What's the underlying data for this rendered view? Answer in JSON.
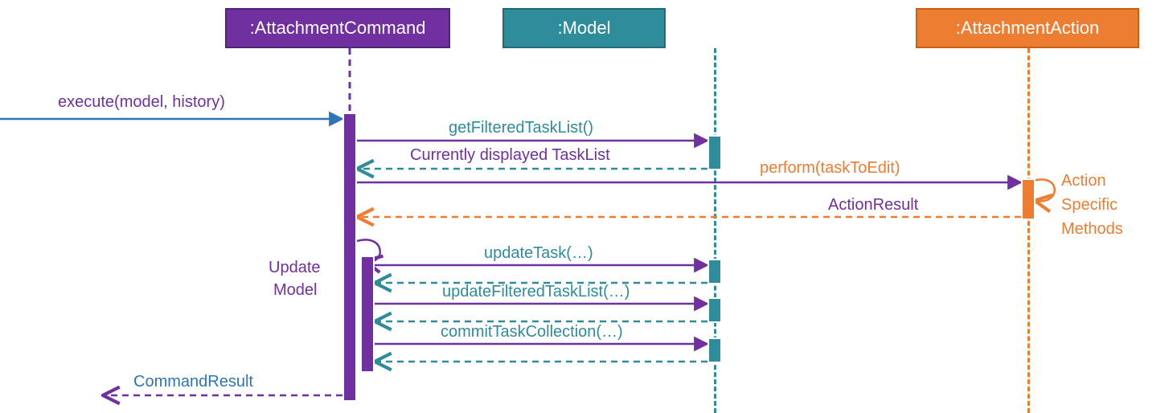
{
  "chart_data": {
    "type": "sequence-diagram",
    "lifelines": [
      {
        "id": "attachmentCommand",
        "label": ":AttachmentCommand",
        "color": "purple"
      },
      {
        "id": "model",
        "label": ":Model",
        "color": "teal"
      },
      {
        "id": "attachmentAction",
        "label": ":AttachmentAction",
        "color": "orange"
      }
    ],
    "messages": [
      {
        "from": "ext",
        "to": "attachmentCommand",
        "label": "execute(model, history)",
        "kind": "call"
      },
      {
        "from": "attachmentCommand",
        "to": "model",
        "label": "getFilteredTaskList()",
        "kind": "call"
      },
      {
        "from": "model",
        "to": "attachmentCommand",
        "label": "Currently displayed TaskList",
        "kind": "return"
      },
      {
        "from": "attachmentCommand",
        "to": "attachmentAction",
        "label": "perform(taskToEdit)",
        "kind": "call"
      },
      {
        "from": "attachmentAction",
        "to": "attachmentAction",
        "label": "Action Specific Methods",
        "kind": "self"
      },
      {
        "from": "attachmentAction",
        "to": "attachmentCommand",
        "label": "ActionResult",
        "kind": "return"
      },
      {
        "from": "attachmentCommand",
        "to": "attachmentCommand",
        "label": "Update Model",
        "kind": "self"
      },
      {
        "from": "attachmentCommand",
        "to": "model",
        "label": "updateTask(…)",
        "kind": "call-return"
      },
      {
        "from": "attachmentCommand",
        "to": "model",
        "label": "updateFilteredTaskList(…)",
        "kind": "call-return"
      },
      {
        "from": "attachmentCommand",
        "to": "model",
        "label": "commitTaskCollection(…)",
        "kind": "call-return"
      },
      {
        "from": "attachmentCommand",
        "to": "ext",
        "label": "CommandResult",
        "kind": "return"
      }
    ]
  },
  "headers": {
    "attachmentCommand": ":AttachmentCommand",
    "model": ":Model",
    "attachmentAction": ":AttachmentAction"
  },
  "labels": {
    "execute": "execute(model, history)",
    "getFiltered": "getFilteredTaskList()",
    "currentlyDisplayed": "Currently displayed TaskList",
    "perform": "perform(taskToEdit)",
    "actionResult": "ActionResult",
    "actionSpecific1": "Action",
    "actionSpecific2": "Specific",
    "actionSpecific3": "Methods",
    "updateModel1": "Update",
    "updateModel2": "Model",
    "updateTask": "updateTask(…)",
    "updateFilteredTaskList": "updateFilteredTaskList(…)",
    "commitTaskCollection": "commitTaskCollection(…)",
    "commandResult": "CommandResult"
  }
}
